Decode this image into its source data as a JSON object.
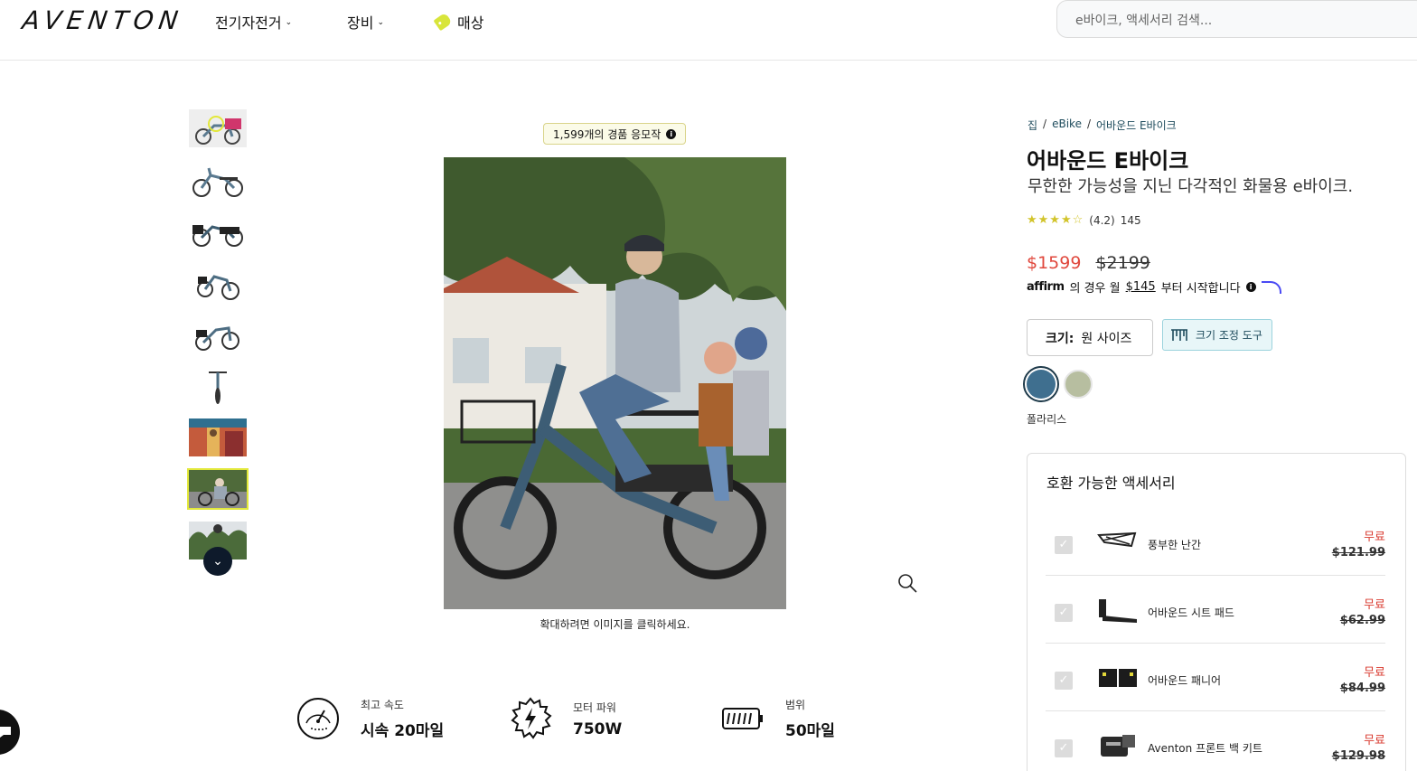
{
  "header": {
    "logo": "AVENTON",
    "nav": [
      {
        "label": "전기자전거",
        "chevron": "⌄"
      },
      {
        "label": "장비",
        "chevron": "⌄"
      },
      {
        "label": "매상"
      }
    ],
    "search_placeholder": "e바이크, 액세서리 검색..."
  },
  "gallery": {
    "review_badge": "1,599개의 경품 응모작",
    "click_hint": "확대하려면 이미지를 클릭하세요.",
    "thumbnails": 9,
    "active_thumbnail": 8
  },
  "specs": [
    {
      "label": "최고 속도",
      "value": "시속 20마일",
      "icon": "speedometer-icon"
    },
    {
      "label": "모터 파워",
      "value": "750W",
      "icon": "lightning-gear-icon"
    },
    {
      "label": "범위",
      "value": "50마일",
      "icon": "battery-icon"
    }
  ],
  "product": {
    "breadcrumb": [
      "집",
      "eBike",
      "어바운드 E바이크"
    ],
    "title": "어바운드 E바이크",
    "subtitle": "무한한 가능성을 지닌 다각적인 화물용 e바이크.",
    "stars": "★★★★☆",
    "rating": "(4.2)",
    "review_count": "145",
    "price_sale": "$1599",
    "price_original": "$2199",
    "affirm": {
      "logo": "affirm",
      "pre": "의 경우 월",
      "amount": "$145",
      "post": "부터 시작합니다"
    },
    "size_label": "크기:",
    "size_value": "원 사이즈",
    "size_tool": "크기 조정 도구",
    "colors": [
      "#3f6f8f",
      "#b7bea0"
    ],
    "color_name": "폴라리스",
    "accent_color": "#e0473c"
  },
  "accessories": {
    "title": "호환 가능한 액세서리",
    "items": [
      {
        "name": "풍부한 난간",
        "free": "무료",
        "was": "$121.99"
      },
      {
        "name": "어바운드 시트 패드",
        "free": "무료",
        "was": "$62.99"
      },
      {
        "name": "어바운드 패니어",
        "free": "무료",
        "was": "$84.99"
      },
      {
        "name": "Aventon 프론트 백 키트",
        "free": "무료",
        "was": "$129.98"
      }
    ]
  }
}
